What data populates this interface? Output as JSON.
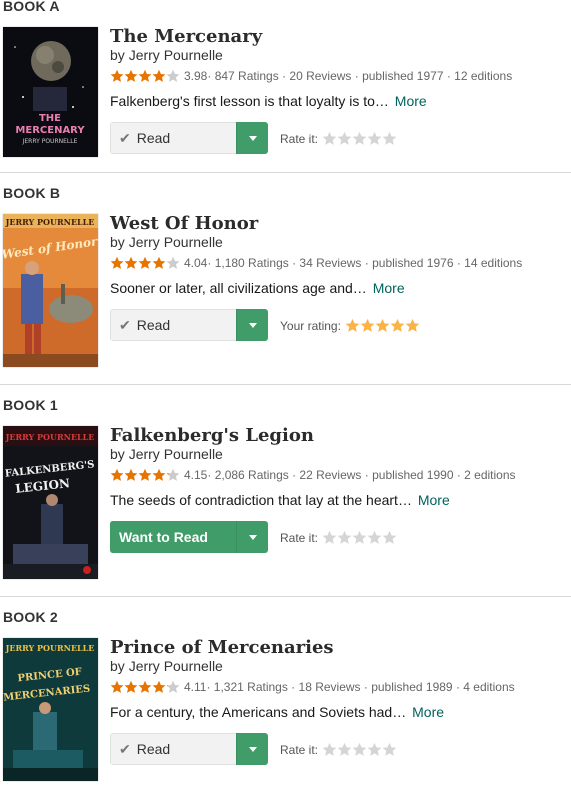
{
  "books": [
    {
      "label": "BOOK A",
      "title": "The Mercenary",
      "author_prefix": "by",
      "author": "Jerry Pournelle",
      "avg_rating": "3.98",
      "rating_stars": 4,
      "meta_rest": " · 847 Ratings · 20 Reviews · published 1977 · 12 editions",
      "description": "Falkenberg's first lesson is that loyalty is to…",
      "more": "More",
      "shelf_label": "Read",
      "shelf_state": "read",
      "rate_label": "Rate it:",
      "user_rating": 0,
      "cover_text": [
        "THE",
        "MERCENARY",
        "JERRY POURNELLE"
      ]
    },
    {
      "label": "BOOK B",
      "title": "West Of Honor",
      "author_prefix": "by",
      "author": "Jerry Pournelle",
      "avg_rating": "4.04",
      "rating_stars": 4,
      "meta_rest": " · 1,180 Ratings · 34 Reviews · published 1976 · 14 editions",
      "description": "Sooner or later, all civilizations age and…",
      "more": "More",
      "shelf_label": "Read",
      "shelf_state": "read",
      "rate_label": "Your rating:",
      "user_rating": 5,
      "cover_text": [
        "JERRY POURNELLE",
        "West of Honor"
      ]
    },
    {
      "label": "BOOK 1",
      "title": "Falkenberg's Legion",
      "author_prefix": "by",
      "author": "Jerry Pournelle",
      "avg_rating": "4.15",
      "rating_stars": 4,
      "meta_rest": " · 2,086 Ratings · 22 Reviews · published 1990 · 2 editions",
      "description": "The seeds of contradiction that lay at the heart…",
      "more": "More",
      "shelf_label": "Want to Read",
      "shelf_state": "want",
      "rate_label": "Rate it:",
      "user_rating": 0,
      "cover_text": [
        "JERRY POURNELLE",
        "FALKENBERG'S",
        "LEGION"
      ]
    },
    {
      "label": "BOOK 2",
      "title": "Prince of Mercenaries",
      "author_prefix": "by",
      "author": "Jerry Pournelle",
      "avg_rating": "4.11",
      "rating_stars": 4,
      "meta_rest": " · 1,321 Ratings · 18 Reviews · published 1989 · 4 editions",
      "description": "For a century, the Americans and Soviets had…",
      "more": "More",
      "shelf_label": "Read",
      "shelf_state": "read",
      "rate_label": "Rate it:",
      "user_rating": 0,
      "cover_text": [
        "JERRY POURNELLE",
        "PRINCE OF",
        "MERCENARIES"
      ]
    }
  ],
  "colors": {
    "star_filled": "#e87400",
    "star_empty": "#cccccc",
    "user_star": "#fab445",
    "green": "#409d69",
    "link": "#00635d"
  }
}
